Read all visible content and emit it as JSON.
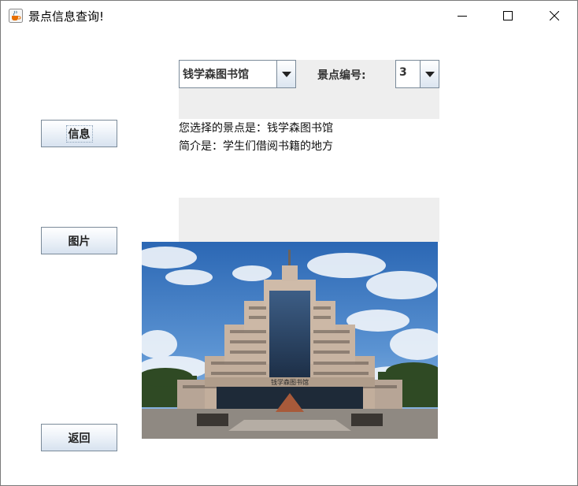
{
  "window": {
    "title": "景点信息查询!",
    "icon": "java-cup-icon"
  },
  "buttons": {
    "info": "信息",
    "picture": "图片",
    "back": "返回"
  },
  "selector": {
    "spot_value": "钱学森图书馆",
    "number_label": "景点编号:",
    "number_value": "3"
  },
  "info": {
    "line1": "您选择的景点是：钱学森图书馆",
    "line2": "简介是：学生们借阅书籍的地方"
  },
  "photo": {
    "sign_text": "钱学森图书馆"
  }
}
